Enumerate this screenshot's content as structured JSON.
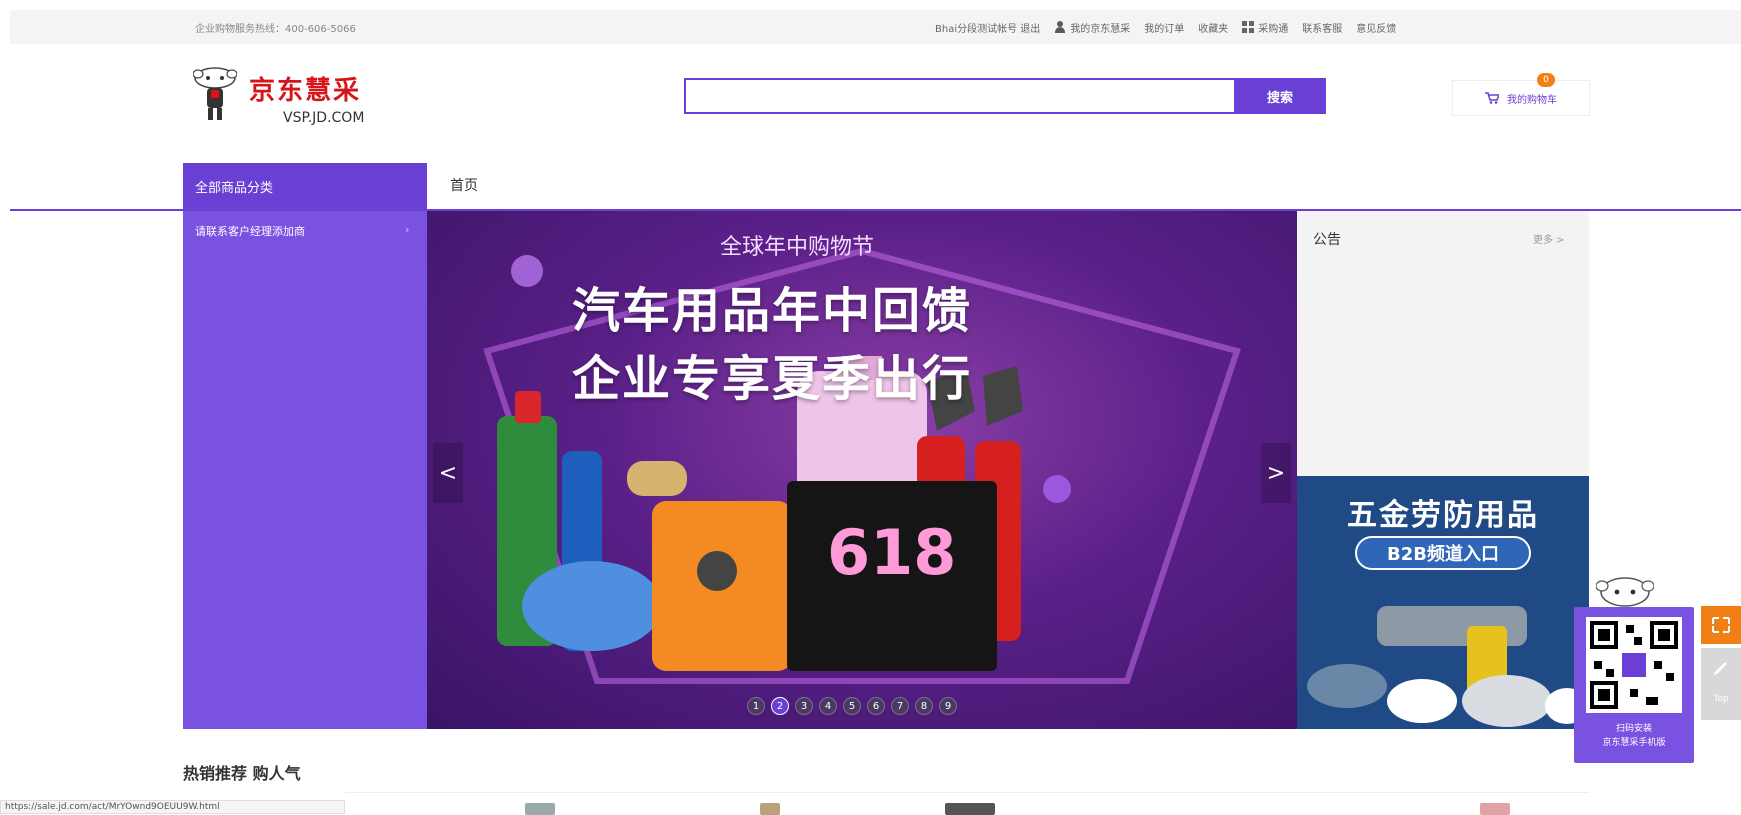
{
  "topbar": {
    "hotline": "企业购物服务热线：400-606-5066",
    "links": [
      {
        "label": "Bhai分段测试帐号 退出",
        "icon": ""
      },
      {
        "label": "我的京东慧采",
        "icon": "user-icon"
      },
      {
        "label": "我的订单",
        "icon": ""
      },
      {
        "label": "收藏夹",
        "icon": ""
      },
      {
        "label": "采购通",
        "icon": "grid-icon"
      },
      {
        "label": "联系客服",
        "icon": ""
      },
      {
        "label": "意见反馈",
        "icon": ""
      }
    ]
  },
  "logo": {
    "cn": "京东慧采",
    "en": "VSP.JD.COM"
  },
  "search": {
    "placeholder": "",
    "button": "搜索"
  },
  "cart": {
    "label": "我的购物车",
    "count": "0"
  },
  "nav": {
    "all_categories": "全部商品分类",
    "home": "首页"
  },
  "category_panel": {
    "item": "请联系客户经理添加商",
    "arrow": "›"
  },
  "banner": {
    "subtitle": "全球年中购物节",
    "headline1": "汽车用品年中回馈",
    "headline2": "企业专享夏季出行",
    "badge": "618",
    "prev": "<",
    "next": ">",
    "pages": [
      "1",
      "2",
      "3",
      "4",
      "5",
      "6",
      "7",
      "8",
      "9"
    ],
    "active_page": 2
  },
  "notice": {
    "title": "公告",
    "more": "更多 >"
  },
  "ad": {
    "title": "五金劳防用品",
    "pill": "B2B频道入口"
  },
  "floating": {
    "caption1": "扫码安装",
    "caption2": "京东慧采手机版",
    "side_label": "Top"
  },
  "hot": {
    "title": "热销推荐 购人气"
  },
  "statusbar": {
    "url": "https://sale.jd.com/act/MrYOwnd9OEUU9W.html"
  },
  "colors": {
    "purple": "#6a3fd3",
    "red": "#d7141a",
    "orange": "#f07f15",
    "navy": "#1f4a86"
  }
}
